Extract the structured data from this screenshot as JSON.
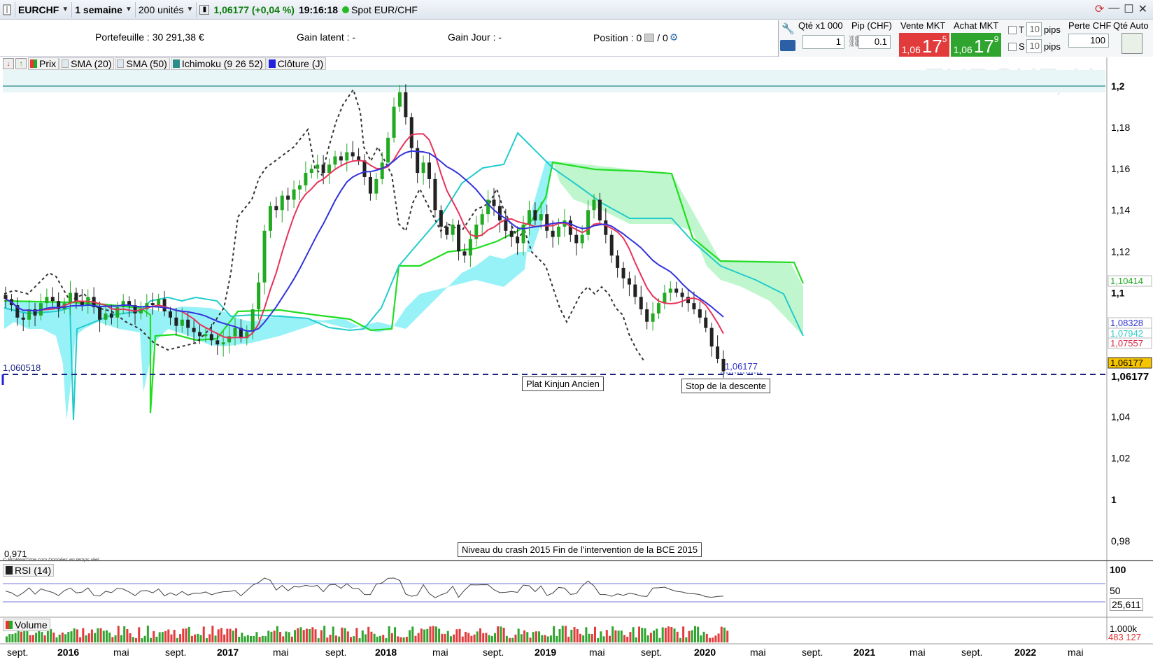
{
  "titlebar": {
    "symbol": "EURCHF",
    "period": "1 semaine",
    "units": "200 unités",
    "price_change": "1,06177 (+0,04 %)",
    "time": "19:16:18",
    "instrument": "Spot EUR/CHF"
  },
  "portfolio": {
    "portefeuille": "Portefeuille : 30 291,38 €",
    "gain_latent": "Gain latent : -",
    "gain_jour": "Gain Jour : -",
    "position": "Position : 0",
    "position2": "/ 0"
  },
  "trade": {
    "qty_label": "Qté x1 000",
    "pip_label": "Pip (CHF)",
    "sell_label": "Vente MKT",
    "buy_label": "Achat MKT",
    "qty_value": "1",
    "pip_value": "0.1",
    "sell_small": "1,06",
    "sell_big": "17",
    "sell_sup": "5",
    "buy_small": "1,06",
    "buy_big": "17",
    "buy_sup": "9",
    "t_label": "T",
    "s_label": "S",
    "t_value": "10",
    "s_value": "10",
    "pips_label": "pips",
    "loss_label": "Perte CHF",
    "loss_value": "100",
    "auto_label": "Qté Auto"
  },
  "legend": {
    "items": [
      {
        "label": "Prix",
        "color": "#2aa52a"
      },
      {
        "label": "SMA (20)",
        "color": "#cfe8f0"
      },
      {
        "label": "SMA (50)",
        "color": "#cfe8f0"
      },
      {
        "label": "Ichimoku (9 26 52)",
        "color": "#2c8c8c"
      },
      {
        "label": "Clôture (J)",
        "color": "#2222dd"
      }
    ]
  },
  "watermark": "EURCHF, H",
  "chart_data": {
    "type": "candlestick",
    "yaxis_ticks": [
      "1,2",
      "1,18",
      "1,16",
      "1,14",
      "1,12",
      "1,1",
      "1,06177",
      "1,04",
      "1,02",
      "1",
      "0,98"
    ],
    "ylim": [
      0.971,
      1.2
    ],
    "y_low_label": "0,971",
    "x_ticks": [
      "sept.",
      "2016",
      "mai",
      "sept.",
      "2017",
      "mai",
      "sept.",
      "2018",
      "mai",
      "sept.",
      "2019",
      "mai",
      "sept.",
      "2020",
      "mai",
      "sept.",
      "2021",
      "mai",
      "sept.",
      "2022",
      "mai"
    ],
    "right_labels": [
      {
        "text": "1,10414",
        "color": "#22aa22"
      },
      {
        "text": "1,08328",
        "color": "#3333cc"
      },
      {
        "text": "1,07942",
        "color": "#33cccc"
      },
      {
        "text": "1,07557",
        "color": "#dd2244"
      },
      {
        "text": "1,06177",
        "color": "#000000"
      }
    ],
    "levels": [
      {
        "value": 1.060518,
        "label": "1,060518"
      },
      {
        "value": 1.2,
        "label": "1,2"
      }
    ],
    "last_price_label": "1,06177",
    "annotations": [
      "Plat Kinjun Ancien",
      "Stop de la descente",
      "Niveau du crash 2015 Fin de l'intervention de la BCE 2015"
    ],
    "provider_note": "© ProRealTime.com  Données en temps réel",
    "price_series": [
      1.097,
      1.094,
      1.088,
      1.087,
      1.092,
      1.089,
      1.095,
      1.098,
      1.096,
      1.092,
      1.095,
      1.1,
      1.096,
      1.094,
      1.098,
      1.093,
      1.087,
      1.09,
      1.088,
      1.093,
      1.096,
      1.094,
      1.09,
      1.092,
      1.095,
      1.094,
      1.097,
      1.091,
      1.088,
      1.084,
      1.087,
      1.083,
      1.081,
      1.079,
      1.08,
      1.077,
      1.075,
      1.076,
      1.079,
      1.083,
      1.078,
      1.081,
      1.092,
      1.105,
      1.13,
      1.142,
      1.14,
      1.147,
      1.145,
      1.15,
      1.152,
      1.158,
      1.16,
      1.162,
      1.158,
      1.162,
      1.166,
      1.164,
      1.168,
      1.166,
      1.164,
      1.156,
      1.148,
      1.155,
      1.163,
      1.175,
      1.19,
      1.197,
      1.185,
      1.17,
      1.158,
      1.163,
      1.155,
      1.14,
      1.132,
      1.128,
      1.133,
      1.12,
      1.118,
      1.126,
      1.133,
      1.138,
      1.145,
      1.142,
      1.135,
      1.13,
      1.127,
      1.124,
      1.133,
      1.14,
      1.135,
      1.138,
      1.13,
      1.127,
      1.132,
      1.135,
      1.128,
      1.124,
      1.128,
      1.14,
      1.145,
      1.135,
      1.128,
      1.118,
      1.112,
      1.107,
      1.104,
      1.098,
      1.092,
      1.086,
      1.09,
      1.095,
      1.1,
      1.102,
      1.1,
      1.098,
      1.095,
      1.092,
      1.088,
      1.083,
      1.074,
      1.068,
      1.062
    ],
    "rsi": {
      "label": "RSI (14)",
      "ticks": [
        "100",
        "50"
      ],
      "value": "25,611"
    },
    "volume": {
      "label": "Volume",
      "tick": "1.000k",
      "value": "483 127"
    }
  }
}
